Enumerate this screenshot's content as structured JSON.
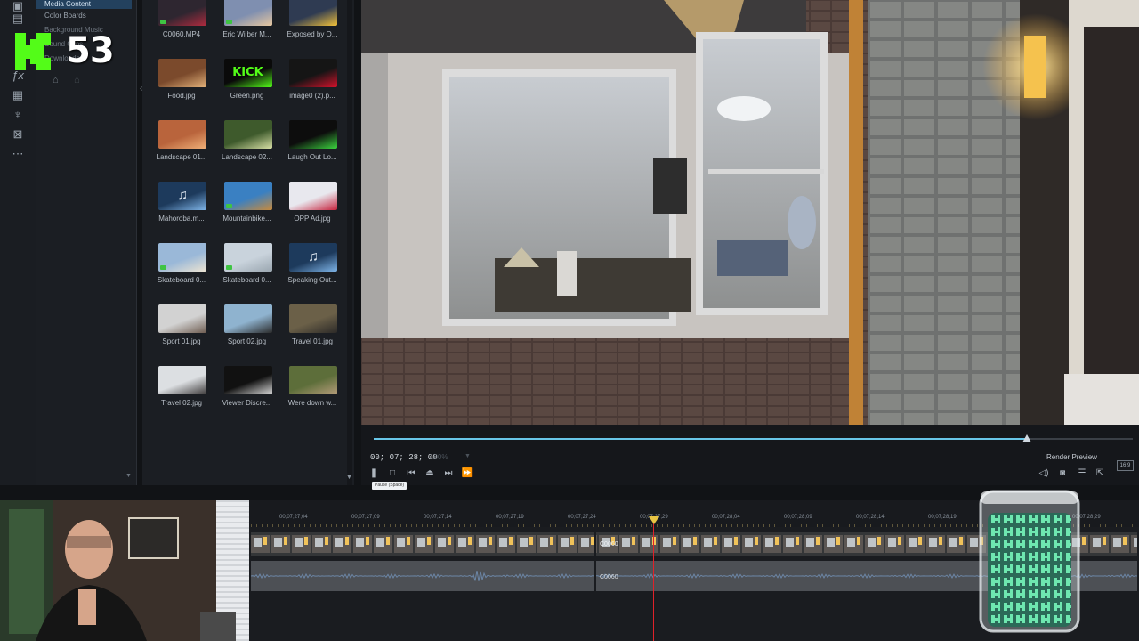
{
  "tree": {
    "items": [
      "Media Content",
      "Color Boards",
      "Background Music",
      "Sound Clips",
      "Downloaded"
    ]
  },
  "overlay": {
    "badge_text": "53"
  },
  "media": {
    "items": [
      {
        "caption": "C0060.MP4",
        "kind": "video",
        "thumb": "#2e2630",
        "accent": "#b12b3f"
      },
      {
        "caption": "Eric Wilber M...",
        "kind": "video",
        "thumb": "#7f8fb0",
        "accent": "#e8c8a0"
      },
      {
        "caption": "Exposed by O...",
        "kind": "image",
        "thumb": "#2f3b52",
        "accent": "#f3c23a"
      },
      {
        "caption": "Food.jpg",
        "kind": "image",
        "thumb": "#7b4a2c",
        "accent": "#e3b27a"
      },
      {
        "caption": "Green.png",
        "kind": "kick",
        "thumb": "#0a0a0a",
        "accent": "#53fc18"
      },
      {
        "caption": "image0 (2).p...",
        "kind": "image",
        "thumb": "#151515",
        "accent": "#d3122b"
      },
      {
        "caption": "Landscape 01...",
        "kind": "image",
        "thumb": "#b9643c",
        "accent": "#f0b078"
      },
      {
        "caption": "Landscape 02...",
        "kind": "image",
        "thumb": "#3e5a2c",
        "accent": "#d8e0a6"
      },
      {
        "caption": "Laugh Out Lo...",
        "kind": "image",
        "thumb": "#0d0d0d",
        "accent": "#3cd43f"
      },
      {
        "caption": "Mahoroba.m...",
        "kind": "audio",
        "thumb": "#1d3a5c",
        "accent": "#7fb5e8"
      },
      {
        "caption": "Mountainbike...",
        "kind": "video",
        "thumb": "#3a80c2",
        "accent": "#c88a3c"
      },
      {
        "caption": "OPP Ad.jpg",
        "kind": "image",
        "thumb": "#e8e8ee",
        "accent": "#c6233d"
      },
      {
        "caption": "Skateboard 0...",
        "kind": "video",
        "thumb": "#9ab8d8",
        "accent": "#ede4d2"
      },
      {
        "caption": "Skateboard 0...",
        "kind": "video",
        "thumb": "#c9d3dc",
        "accent": "#9aa6b0"
      },
      {
        "caption": "Speaking Out...",
        "kind": "audio",
        "thumb": "#1d3a5c",
        "accent": "#7fb5e8"
      },
      {
        "caption": "Sport 01.jpg",
        "kind": "image",
        "thumb": "#d2d2d2",
        "accent": "#6e5c50"
      },
      {
        "caption": "Sport 02.jpg",
        "kind": "image",
        "thumb": "#8fb3cf",
        "accent": "#2b2b2b"
      },
      {
        "caption": "Travel 01.jpg",
        "kind": "image",
        "thumb": "#6b6048",
        "accent": "#2c2a28"
      },
      {
        "caption": "Travel 02.jpg",
        "kind": "image",
        "thumb": "#dcdfe2",
        "accent": "#3d3a3a"
      },
      {
        "caption": "Viewer Discre...",
        "kind": "image",
        "thumb": "#111111",
        "accent": "#d8d8d8"
      },
      {
        "caption": "Were down w...",
        "kind": "image",
        "thumb": "#5d6e3a",
        "accent": "#b59c7a"
      }
    ]
  },
  "preview": {
    "timecode": "00; 07; 28; 00",
    "zoom": "100%",
    "progress": 0.86,
    "render_preview_label": "Render Preview",
    "tooltip": "Pause (Space)",
    "aspect": "16:9"
  },
  "timeline": {
    "ruler_labels": [
      "00;07;27;04",
      "00;07;27;09",
      "00;07;27;14",
      "00;07;27;19",
      "00;07;27;24",
      "00;07;27;29",
      "00;07;28;04",
      "00;07;28;09",
      "00;07;28;14",
      "00;07;28;19",
      "00;07;28;29"
    ],
    "clip_name_video": "C0060",
    "clip_name_audio": "C0060"
  },
  "colors": {
    "accent": "#68c6e8",
    "playhead": "#e0222a",
    "selection": "#23415e",
    "logo": "#53fc18"
  }
}
